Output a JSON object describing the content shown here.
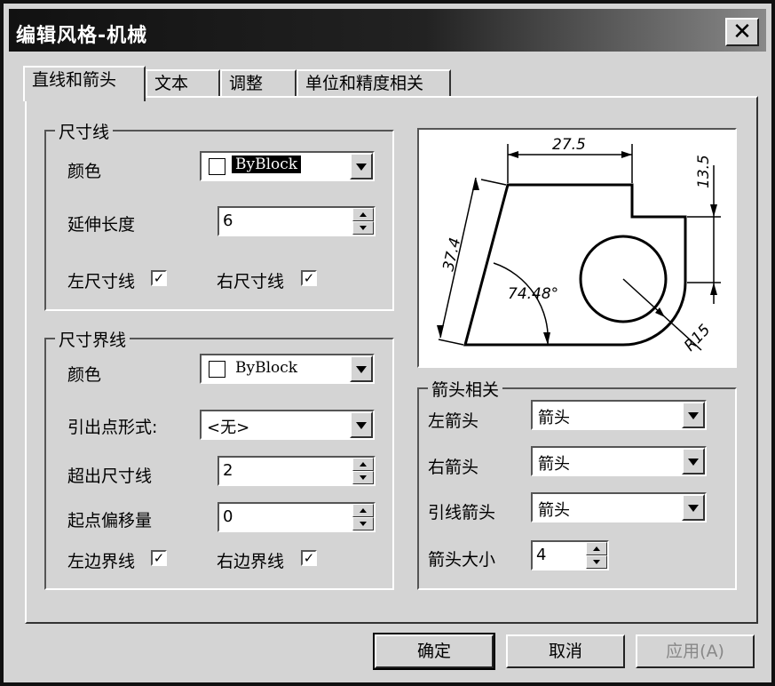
{
  "window": {
    "title": "编辑风格-机械",
    "close_label": "✕"
  },
  "tabs": [
    {
      "label": "直线和箭头"
    },
    {
      "label": "文本"
    },
    {
      "label": "调整"
    },
    {
      "label": "单位和精度相关"
    }
  ],
  "dim_line": {
    "title": "尺寸线",
    "color_label": "颜色",
    "color_value": "ByBlock",
    "extend_label": "延伸长度",
    "extend_value": "6",
    "left_label": "左尺寸线",
    "right_label": "右尺寸线",
    "left_checked": true,
    "right_checked": true
  },
  "ext_line": {
    "title": "尺寸界线",
    "color_label": "颜色",
    "color_value": "ByBlock",
    "origin_label": "引出点形式:",
    "origin_value": "<无>",
    "beyond_label": "超出尺寸线",
    "beyond_value": "2",
    "offset_label": "起点偏移量",
    "offset_value": "0",
    "left_label": "左边界线",
    "right_label": "右边界线",
    "left_checked": true,
    "right_checked": true
  },
  "preview": {
    "dim_top": "27.5",
    "dim_right": "13.5",
    "dim_left": "37.4",
    "dim_angle": "74.48°",
    "dim_radius": "R15"
  },
  "arrows": {
    "title": "箭头相关",
    "left_label": "左箭头",
    "left_value": "箭头",
    "right_label": "右箭头",
    "right_value": "箭头",
    "leader_label": "引线箭头",
    "leader_value": "箭头",
    "size_label": "箭头大小",
    "size_value": "4"
  },
  "buttons": {
    "ok": "确定",
    "cancel": "取消",
    "apply": "应用(A)"
  },
  "check_mark": "✓"
}
